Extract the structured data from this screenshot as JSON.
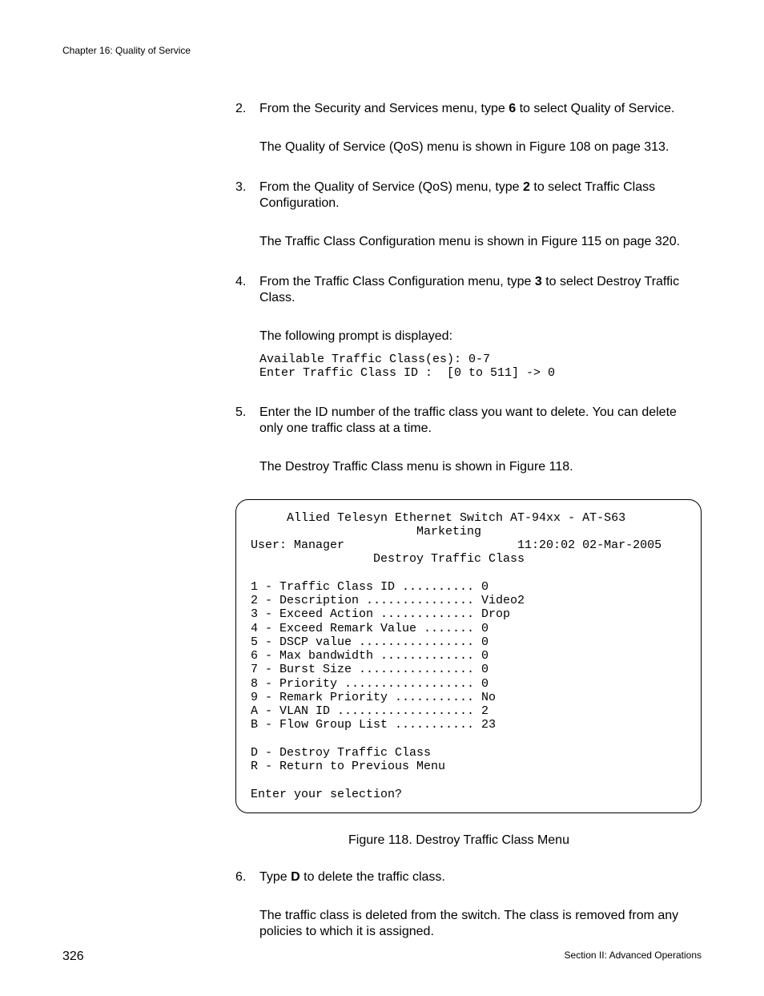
{
  "chapter_header": "Chapter 16: Quality of Service",
  "steps": {
    "s2": {
      "num": "2.",
      "text_a": "From the Security and Services menu, type ",
      "bold": "6",
      "text_b": " to select Quality of Service.",
      "follow": "The Quality of Service (QoS) menu is shown in Figure 108 on page 313."
    },
    "s3": {
      "num": "3.",
      "text_a": "From the Quality of Service (QoS) menu, type ",
      "bold": "2",
      "text_b": " to select Traffic Class Configuration.",
      "follow": "The Traffic Class Configuration menu is shown in Figure 115 on page 320."
    },
    "s4": {
      "num": "4.",
      "text_a": "From the Traffic Class Configuration menu, type ",
      "bold": "3",
      "text_b": " to select Destroy Traffic Class.",
      "follow": "The following prompt is displayed:",
      "prompt": "Available Traffic Class(es): 0-7\nEnter Traffic Class ID :  [0 to 511] -> 0"
    },
    "s5": {
      "num": "5.",
      "text": "Enter the ID number of the traffic class you want to delete. You can delete only one traffic class at a time.",
      "follow": "The Destroy Traffic Class menu is shown in Figure 118."
    },
    "s6": {
      "num": "6.",
      "text_a": "Type ",
      "bold": "D",
      "text_b": " to delete the traffic class.",
      "follow": "The traffic class is deleted from the switch. The class is removed from any policies to which it is assigned."
    }
  },
  "menu": "     Allied Telesyn Ethernet Switch AT-94xx - AT-S63\n                       Marketing\nUser: Manager                        11:20:02 02-Mar-2005\n                 Destroy Traffic Class\n\n1 - Traffic Class ID .......... 0\n2 - Description ............... Video2\n3 - Exceed Action ............. Drop\n4 - Exceed Remark Value ....... 0\n5 - DSCP value ................ 0\n6 - Max bandwidth ............. 0\n7 - Burst Size ................ 0\n8 - Priority .................. 0\n9 - Remark Priority ........... No\nA - VLAN ID ................... 2\nB - Flow Group List ........... 23\n\nD - Destroy Traffic Class\nR - Return to Previous Menu\n\nEnter your selection?",
  "figure_caption": "Figure 118. Destroy Traffic Class Menu",
  "footer": {
    "page": "326",
    "section": "Section II: Advanced Operations"
  }
}
